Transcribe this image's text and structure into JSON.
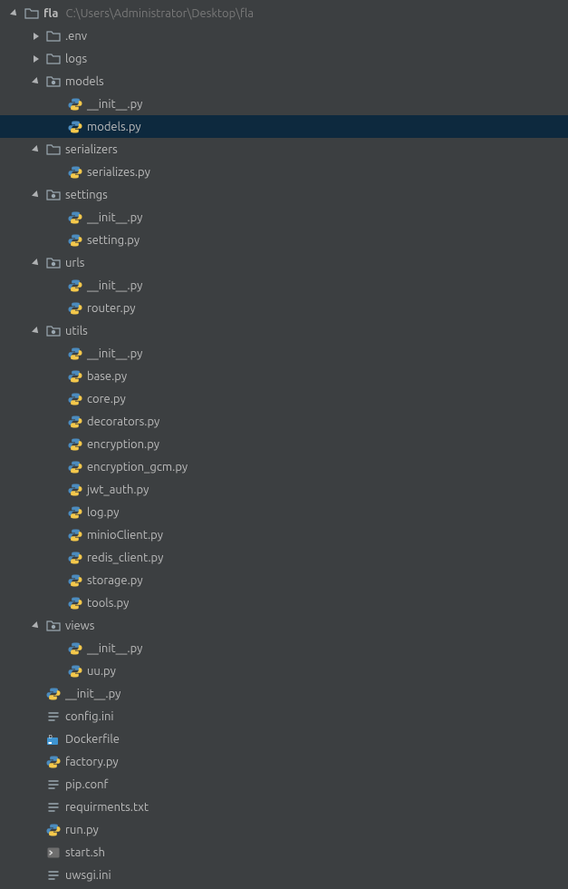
{
  "root": {
    "name": "fla",
    "path": "C:\\Users\\Administrator\\Desktop\\fla",
    "kind": "folder-root",
    "expanded": true,
    "children": [
      {
        "name": ".env",
        "kind": "folder",
        "expanded": false
      },
      {
        "name": "logs",
        "kind": "folder",
        "expanded": false
      },
      {
        "name": "models",
        "kind": "pkg",
        "expanded": true,
        "children": [
          {
            "name": "__init__.py",
            "kind": "py"
          },
          {
            "name": "models.py",
            "kind": "py",
            "selected": true
          }
        ]
      },
      {
        "name": "serializers",
        "kind": "folder",
        "expanded": true,
        "children": [
          {
            "name": "serializes.py",
            "kind": "py"
          }
        ]
      },
      {
        "name": "settings",
        "kind": "pkg",
        "expanded": true,
        "children": [
          {
            "name": "__init__.py",
            "kind": "py"
          },
          {
            "name": "setting.py",
            "kind": "py"
          }
        ]
      },
      {
        "name": "urls",
        "kind": "pkg",
        "expanded": true,
        "children": [
          {
            "name": "__init__.py",
            "kind": "py"
          },
          {
            "name": "router.py",
            "kind": "py"
          }
        ]
      },
      {
        "name": "utils",
        "kind": "pkg",
        "expanded": true,
        "children": [
          {
            "name": "__init__.py",
            "kind": "py"
          },
          {
            "name": "base.py",
            "kind": "py"
          },
          {
            "name": "core.py",
            "kind": "py"
          },
          {
            "name": "decorators.py",
            "kind": "py"
          },
          {
            "name": "encryption.py",
            "kind": "py"
          },
          {
            "name": "encryption_gcm.py",
            "kind": "py"
          },
          {
            "name": "jwt_auth.py",
            "kind": "py"
          },
          {
            "name": "log.py",
            "kind": "py"
          },
          {
            "name": "minioClient.py",
            "kind": "py"
          },
          {
            "name": "redis_client.py",
            "kind": "py"
          },
          {
            "name": "storage.py",
            "kind": "py"
          },
          {
            "name": "tools.py",
            "kind": "py"
          }
        ]
      },
      {
        "name": "views",
        "kind": "pkg",
        "expanded": true,
        "children": [
          {
            "name": "__init__.py",
            "kind": "py"
          },
          {
            "name": "uu.py",
            "kind": "py"
          }
        ]
      },
      {
        "name": "__init__.py",
        "kind": "py"
      },
      {
        "name": "config.ini",
        "kind": "text"
      },
      {
        "name": "Dockerfile",
        "kind": "docker"
      },
      {
        "name": "factory.py",
        "kind": "py"
      },
      {
        "name": "pip.conf",
        "kind": "text"
      },
      {
        "name": "requirments.txt",
        "kind": "text"
      },
      {
        "name": "run.py",
        "kind": "py"
      },
      {
        "name": "start.sh",
        "kind": "sh"
      },
      {
        "name": "uwsgi.ini",
        "kind": "text"
      }
    ]
  }
}
